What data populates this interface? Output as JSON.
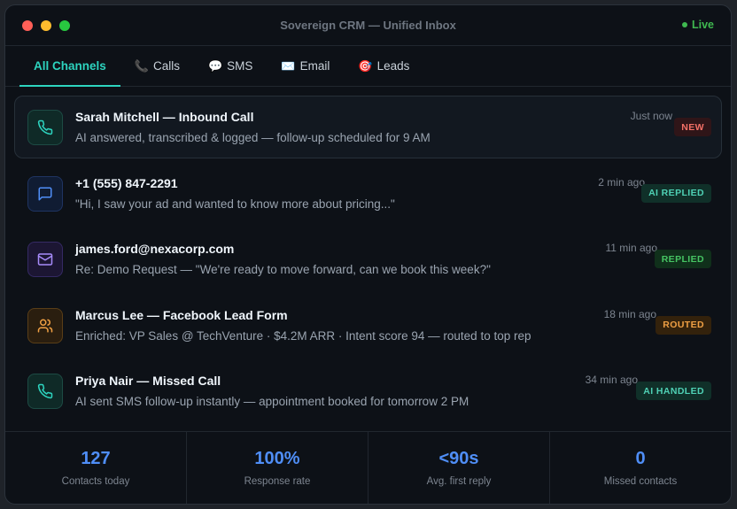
{
  "window": {
    "title": "Sovereign CRM — Unified Inbox",
    "status": "Live"
  },
  "tabs": [
    {
      "label": "All Channels",
      "icon": ""
    },
    {
      "label": "Calls",
      "icon": "📞"
    },
    {
      "label": "SMS",
      "icon": "💬"
    },
    {
      "label": "Email",
      "icon": "✉️"
    },
    {
      "label": "Leads",
      "icon": "🎯"
    }
  ],
  "messages": [
    {
      "icon": "phone-icon",
      "title": "Sarah Mitchell — Inbound Call",
      "subtitle": "AI answered, transcribed & logged — follow-up scheduled for 9 AM",
      "time": "Just now",
      "badge": "NEW"
    },
    {
      "icon": "chat-icon",
      "title": "+1 (555) 847-2291",
      "subtitle": "\"Hi, I saw your ad and wanted to know more about pricing...\"",
      "time": "2 min ago",
      "badge": "AI REPLIED"
    },
    {
      "icon": "mail-icon",
      "title": "james.ford@nexacorp.com",
      "subtitle": "Re: Demo Request — \"We're ready to move forward, can we book this week?\"",
      "time": "11 min ago",
      "badge": "REPLIED"
    },
    {
      "icon": "users-icon",
      "title": "Marcus Lee — Facebook Lead Form",
      "subtitle": "Enriched: VP Sales @ TechVenture · $4.2M ARR · Intent score 94 — routed to top rep",
      "time": "18 min ago",
      "badge": "ROUTED"
    },
    {
      "icon": "phone-icon",
      "title": "Priya Nair — Missed Call",
      "subtitle": "AI sent SMS follow-up instantly — appointment booked for tomorrow 2 PM",
      "time": "34 min ago",
      "badge": "AI HANDLED"
    }
  ],
  "stats": [
    {
      "value": "127",
      "label": "Contacts today"
    },
    {
      "value": "100%",
      "label": "Response rate"
    },
    {
      "value": "<90s",
      "label": "Avg. first reply"
    },
    {
      "value": "0",
      "label": "Missed contacts"
    }
  ],
  "colors": {
    "accent": "#2dd4bf",
    "stat": "#4f8ef7",
    "live": "#3fb950"
  }
}
